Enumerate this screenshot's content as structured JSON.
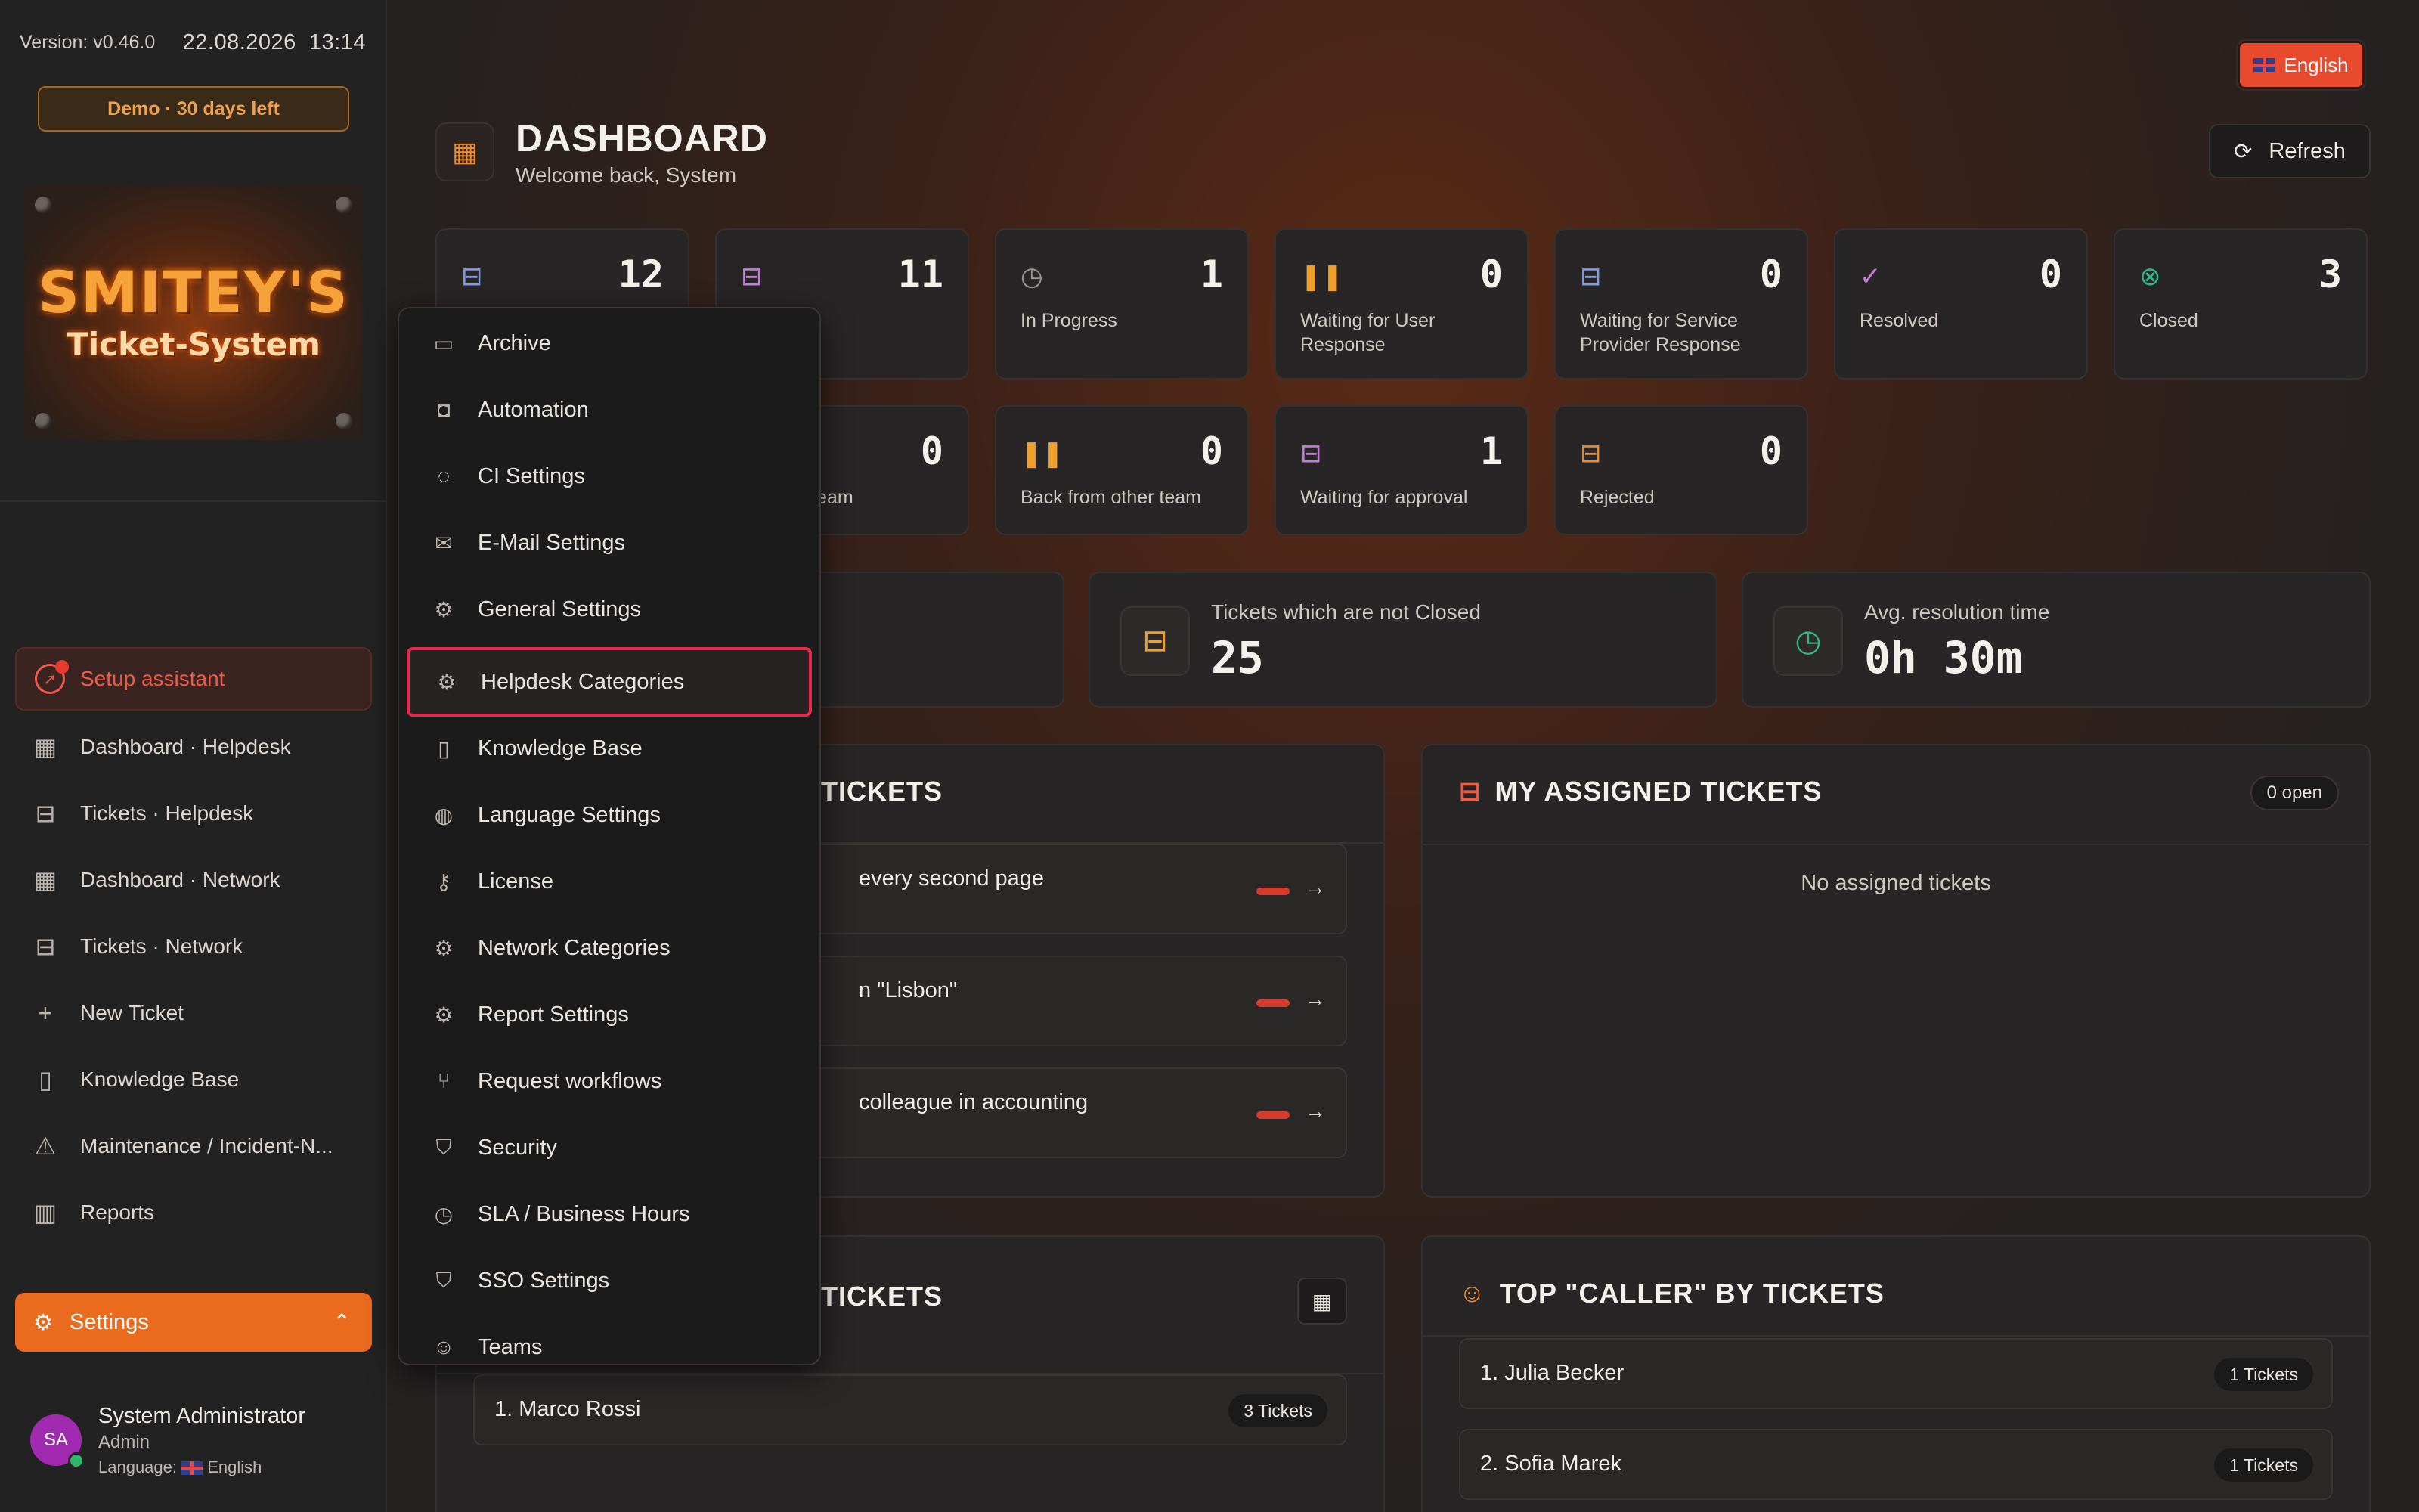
{
  "meta": {
    "version": "Version: v0.46.0",
    "date": "22.08.2026",
    "time": "13:14",
    "demo": "Demo · 30 days left"
  },
  "logo": {
    "line1": "SMITEY'S",
    "line2": "Ticket-System"
  },
  "sidebar": {
    "setup": "Setup assistant",
    "items": [
      {
        "label": "Dashboard · Helpdesk",
        "icon": "dashboard-icon"
      },
      {
        "label": "Tickets · Helpdesk",
        "icon": "ticket-icon"
      },
      {
        "label": "Dashboard · Network",
        "icon": "dashboard-icon"
      },
      {
        "label": "Tickets · Network",
        "icon": "ticket-icon"
      },
      {
        "label": "New Ticket",
        "icon": "plus-icon"
      },
      {
        "label": "Knowledge Base",
        "icon": "book-icon"
      },
      {
        "label": "Maintenance / Incident-N...",
        "icon": "warning-icon"
      },
      {
        "label": "Reports",
        "icon": "chart-icon"
      }
    ],
    "settings": "Settings"
  },
  "user": {
    "initials": "SA",
    "name": "System Administrator",
    "role": "Admin",
    "language_label": "Language:",
    "language": "English"
  },
  "header": {
    "language_button": "English",
    "title": "DASHBOARD",
    "subtitle": "Welcome back, System",
    "refresh": "Refresh"
  },
  "status_cards": [
    {
      "value": "12",
      "label": "",
      "color": "#7a9cf0"
    },
    {
      "value": "11",
      "label": "",
      "color": "#c87ae0"
    },
    {
      "value": "1",
      "label": "In Progress",
      "color": "#9a9490"
    },
    {
      "value": "0",
      "label": "Waiting for User Response",
      "color": "#f0a02a"
    },
    {
      "value": "0",
      "label": "Waiting for Service Provider Response",
      "color": "#7a9cf0"
    },
    {
      "value": "0",
      "label": "Resolved",
      "color": "#c87ae0"
    },
    {
      "value": "3",
      "label": "Closed",
      "color": "#2fb88a"
    },
    {
      "value": "0",
      "label": "or other team",
      "color": "#7a9cf0"
    },
    {
      "value": "0",
      "label": "Back from other team",
      "color": "#f0a02a"
    },
    {
      "value": "1",
      "label": "Waiting for approval",
      "color": "#c87ae0"
    },
    {
      "value": "0",
      "label": "Rejected",
      "color": "#f08a2a"
    }
  ],
  "stats": [
    {
      "label": "Tickets which are not Closed",
      "value": "25",
      "color": "#f0a02a"
    },
    {
      "label": "Avg. resolution time",
      "value": "0h 30m",
      "color": "#2fb88a"
    }
  ],
  "latest_panel": {
    "title": "TICKETS",
    "rows": [
      "every second page",
      "n \"Lisbon\"",
      "colleague in accounting"
    ]
  },
  "assigned_panel": {
    "title": "MY ASSIGNED TICKETS",
    "badge": "0 open",
    "empty": "No assigned tickets"
  },
  "top_panel_left": {
    "title": "TICKETS",
    "rows": [
      {
        "name": "1. Marco Rossi",
        "count": "3 Tickets"
      }
    ]
  },
  "top_panel_right": {
    "title": "TOP \"CALLER\" BY TICKETS",
    "rows": [
      {
        "name": "1. Julia Becker",
        "count": "1 Tickets"
      },
      {
        "name": "2. Sofia Marek",
        "count": "1 Tickets"
      }
    ]
  },
  "settings_menu": {
    "selected": "Helpdesk Categories",
    "items": [
      {
        "label": "Archive",
        "icon": "archive-icon",
        "glyph": "▭"
      },
      {
        "label": "Automation",
        "icon": "robot-icon",
        "glyph": "◘"
      },
      {
        "label": "CI Settings",
        "icon": "palette-icon",
        "glyph": "◌"
      },
      {
        "label": "E-Mail Settings",
        "icon": "mail-icon",
        "glyph": "✉"
      },
      {
        "label": "General Settings",
        "icon": "sliders-icon",
        "glyph": "⚙"
      },
      {
        "label": "Helpdesk Categories",
        "icon": "sliders-icon",
        "glyph": "⚙"
      },
      {
        "label": "Knowledge Base",
        "icon": "book-icon",
        "glyph": "▯"
      },
      {
        "label": "Language Settings",
        "icon": "globe-icon",
        "glyph": "◍"
      },
      {
        "label": "License",
        "icon": "key-icon",
        "glyph": "⚷"
      },
      {
        "label": "Network Categories",
        "icon": "sliders-icon",
        "glyph": "⚙"
      },
      {
        "label": "Report Settings",
        "icon": "sliders-icon",
        "glyph": "⚙"
      },
      {
        "label": "Request workflows",
        "icon": "workflow-icon",
        "glyph": "⑂"
      },
      {
        "label": "Security",
        "icon": "shield-icon",
        "glyph": "⛉"
      },
      {
        "label": "SLA / Business Hours",
        "icon": "timer-icon",
        "glyph": "◷"
      },
      {
        "label": "SSO Settings",
        "icon": "shield-icon",
        "glyph": "⛉"
      },
      {
        "label": "Teams",
        "icon": "users-icon",
        "glyph": "☺"
      }
    ]
  }
}
